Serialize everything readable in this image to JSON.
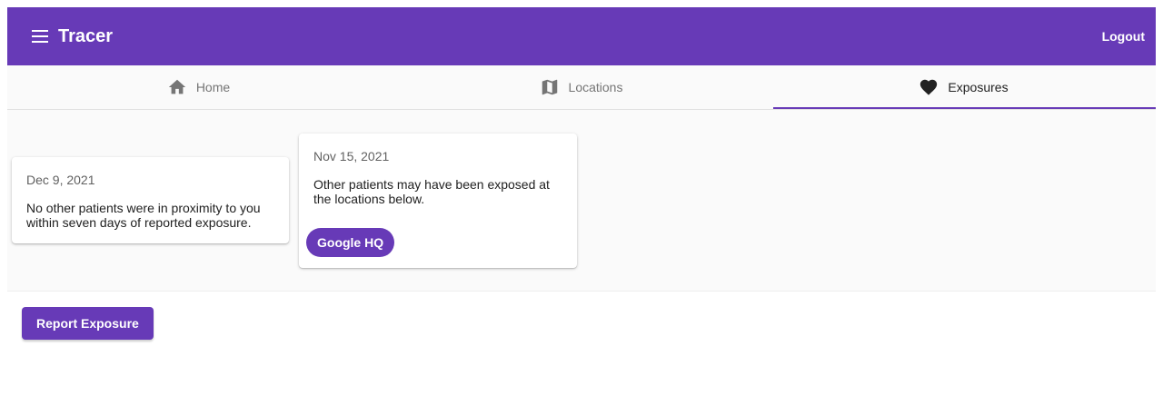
{
  "app": {
    "title": "Tracer",
    "logout_label": "Logout"
  },
  "tabs": [
    {
      "label": "Home",
      "icon": "home-icon",
      "active": false
    },
    {
      "label": "Locations",
      "icon": "map-icon",
      "active": false
    },
    {
      "label": "Exposures",
      "icon": "heart-icon",
      "active": true
    }
  ],
  "exposures": [
    {
      "date": "Dec 9, 2021",
      "message_lines": [
        "No other patients were in proximity to you",
        "within seven days of reported exposure."
      ],
      "locations": []
    },
    {
      "date": "Nov 15, 2021",
      "message_lines": [
        "Other patients may have been exposed at",
        "the locations below."
      ],
      "locations": [
        "Google HQ"
      ]
    }
  ],
  "actions": {
    "report_label": "Report Exposure"
  },
  "colors": {
    "primary": "#673ab7",
    "background": "#fafafa",
    "tab_inactive": "#757575"
  }
}
